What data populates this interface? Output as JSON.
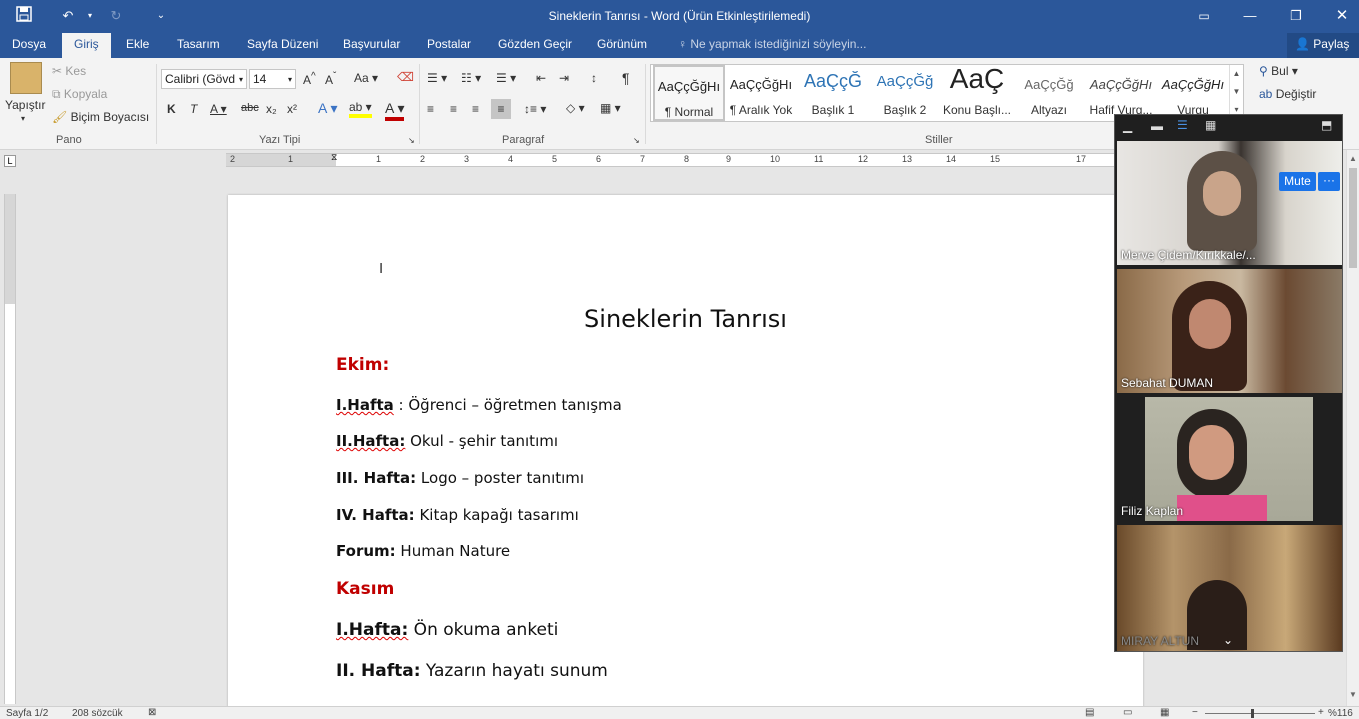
{
  "window": {
    "title": "Sineklerin Tanrısı - Word (Ürün Etkinleştirilemedi)"
  },
  "tabs": [
    "Dosya",
    "Giriş",
    "Ekle",
    "Tasarım",
    "Sayfa Düzeni",
    "Başvurular",
    "Postalar",
    "Gözden Geçir",
    "Görünüm"
  ],
  "tell_me": "Ne yapmak istediğinizi söyleyin...",
  "share_label": "Paylaş",
  "clipboard": {
    "paste": "Yapıştır",
    "cut": "Kes",
    "copy": "Kopyala",
    "format_painter": "Biçim Boyacısı",
    "group": "Pano"
  },
  "font": {
    "name": "Calibri (Gövd",
    "size": "14",
    "group": "Yazı Tipi"
  },
  "paragraph": {
    "group": "Paragraf"
  },
  "styles": {
    "group": "Stiller",
    "items": [
      {
        "sample": "AaÇçĞğHı",
        "name": "¶ Normal"
      },
      {
        "sample": "AaÇçĞğHı",
        "name": "¶ Aralık Yok"
      },
      {
        "sample": "AaÇçĞ",
        "name": "Başlık 1"
      },
      {
        "sample": "AaÇçĞğ",
        "name": "Başlık 2"
      },
      {
        "sample": "AaÇ",
        "name": "Konu Başlı..."
      },
      {
        "sample": "AaÇçĞğ",
        "name": "Altyazı"
      },
      {
        "sample": "AaÇçĞğHı",
        "name": "Hafif Vurg..."
      },
      {
        "sample": "AaÇçĞğHı",
        "name": "Vurgu"
      }
    ]
  },
  "editing": {
    "find": "Bul",
    "replace": "Değiştir"
  },
  "document": {
    "title": "Sineklerin Tanrısı",
    "month1": "Ekim:",
    "lines1": [
      {
        "bold": "I.Hafta",
        "text": " : Öğrenci – öğretmen tanışma"
      },
      {
        "bold": "II.Hafta:",
        "text": " Okul - şehir tanıtımı"
      },
      {
        "bold": "III. Hafta:",
        "text": " Logo – poster tanıtımı"
      },
      {
        "bold": "IV. Hafta:",
        "text": " Kitap kapağı tasarımı"
      },
      {
        "bold": "Forum:",
        "text": " Human Nature"
      }
    ],
    "month2": "Kasım",
    "lines2": [
      {
        "bold": "I.Hafta:",
        "text": " Ön okuma anketi"
      },
      {
        "bold": "II. Hafta:",
        "text": " Yazarın hayatı sunum"
      }
    ]
  },
  "status": {
    "page": "Sayfa 1/2",
    "words": "208 sözcük",
    "zoom": "%116"
  },
  "ruler_numbers": [
    "2",
    "1",
    "1",
    "2",
    "3",
    "4",
    "5",
    "6",
    "7",
    "8",
    "9",
    "10",
    "11",
    "12",
    "13",
    "14",
    "15",
    "17"
  ],
  "zoom_app": {
    "mute_label": "Mute",
    "more_label": "···",
    "participants": [
      {
        "name": "Merve Çidem/Kırıkkale/..."
      },
      {
        "name": "Sebahat DUMAN"
      },
      {
        "name": "Filiz Kaplan"
      },
      {
        "name": "MIRAY ALTUN"
      }
    ]
  },
  "colors": {
    "word_blue": "#2b579a",
    "heading_red": "#c00000",
    "zoom_blue": "#1a73e8"
  }
}
